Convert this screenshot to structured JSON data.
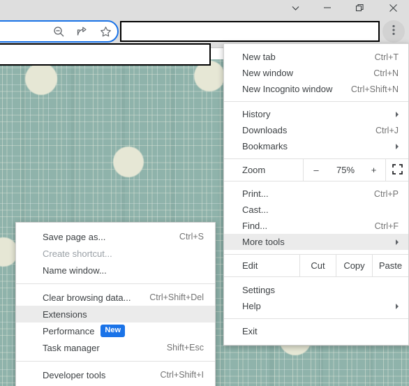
{
  "window_controls": [
    {
      "name": "tab-search",
      "icon": "chevron-down-icon"
    },
    {
      "name": "minimize",
      "icon": "minimize-icon"
    },
    {
      "name": "restore",
      "icon": "restore-icon"
    },
    {
      "name": "close",
      "icon": "close-icon"
    }
  ],
  "toolbar": {
    "omnibox_value": "",
    "omnibox_placeholder": "",
    "icons": [
      {
        "name": "zoom-out-icon"
      },
      {
        "name": "share-icon"
      },
      {
        "name": "bookmark-star-icon"
      }
    ],
    "menu_button": "three-dot-menu-icon"
  },
  "redactions": [
    {
      "name": "redaction-box-top"
    },
    {
      "name": "redaction-box-below"
    }
  ],
  "wallpaper": {
    "base_color": "#8fb3ab",
    "thread_color": "#ecEee0",
    "dot_color": "#e6e7d5"
  },
  "colors": {
    "accent_blue": "#1a73e8",
    "menu_bg": "#ffffff",
    "menu_highlight": "#ebebeb",
    "menu_text": "#3c4043",
    "accel_text": "#737373",
    "disabled_text": "#9aa0a6",
    "chrome_bar": "#dedede"
  },
  "main_menu": {
    "items": [
      {
        "label": "New tab",
        "accel": "Ctrl+T",
        "type": "item"
      },
      {
        "label": "New window",
        "accel": "Ctrl+N",
        "type": "item"
      },
      {
        "label": "New Incognito window",
        "accel": "Ctrl+Shift+N",
        "type": "item"
      },
      {
        "type": "separator"
      },
      {
        "label": "History",
        "accel": "",
        "type": "submenu"
      },
      {
        "label": "Downloads",
        "accel": "Ctrl+J",
        "type": "item"
      },
      {
        "label": "Bookmarks",
        "accel": "",
        "type": "submenu"
      }
    ],
    "zoom_row": {
      "label": "Zoom",
      "minus": "–",
      "level": "75%",
      "plus": "+",
      "fullscreen_icon": "fullscreen-icon"
    },
    "items2": [
      {
        "label": "Print...",
        "accel": "Ctrl+P",
        "type": "item"
      },
      {
        "label": "Cast...",
        "accel": "",
        "type": "item"
      },
      {
        "label": "Find...",
        "accel": "Ctrl+F",
        "type": "item"
      },
      {
        "label": "More tools",
        "accel": "",
        "type": "submenu",
        "highlighted": true
      }
    ],
    "edit_row": {
      "label": "Edit",
      "cut": "Cut",
      "copy": "Copy",
      "paste": "Paste"
    },
    "items3": [
      {
        "label": "Settings",
        "accel": "",
        "type": "item"
      },
      {
        "label": "Help",
        "accel": "",
        "type": "submenu"
      },
      {
        "type": "separator"
      },
      {
        "label": "Exit",
        "accel": "",
        "type": "item"
      }
    ]
  },
  "sub_menu": {
    "items": [
      {
        "label": "Save page as...",
        "accel": "Ctrl+S",
        "type": "item"
      },
      {
        "label": "Create shortcut...",
        "accel": "",
        "type": "item",
        "disabled": true
      },
      {
        "label": "Name window...",
        "accel": "",
        "type": "item"
      },
      {
        "type": "separator"
      },
      {
        "label": "Clear browsing data...",
        "accel": "Ctrl+Shift+Del",
        "type": "item"
      },
      {
        "label": "Extensions",
        "accel": "",
        "type": "item",
        "highlighted": true
      },
      {
        "label": "Performance",
        "accel": "",
        "type": "item",
        "badge": "New"
      },
      {
        "label": "Task manager",
        "accel": "Shift+Esc",
        "type": "item"
      },
      {
        "type": "separator"
      },
      {
        "label": "Developer tools",
        "accel": "Ctrl+Shift+I",
        "type": "item"
      }
    ]
  }
}
